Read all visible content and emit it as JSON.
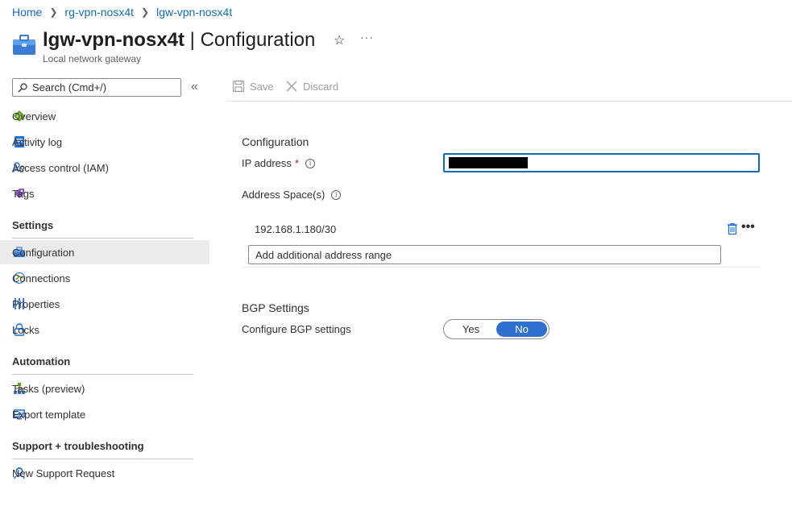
{
  "breadcrumb": {
    "items": [
      "Home",
      "rg-vpn-nosx4t",
      "lgw-vpn-nosx4t"
    ]
  },
  "header": {
    "resource_name": "lgw-vpn-nosx4t",
    "page_name": " | Configuration",
    "resource_type": "Local network gateway",
    "more": "···"
  },
  "sidebar": {
    "search_placeholder": "Search (Cmd+/)",
    "collapse": "«",
    "items_top": [
      {
        "label": "Overview",
        "icon": "overview-icon"
      },
      {
        "label": "Activity log",
        "icon": "activity-log-icon"
      },
      {
        "label": "Access control (IAM)",
        "icon": "iam-icon"
      },
      {
        "label": "Tags",
        "icon": "tag-icon"
      }
    ],
    "sections": [
      {
        "title": "Settings",
        "items": [
          {
            "label": "Configuration",
            "icon": "configuration-icon",
            "active": true
          },
          {
            "label": "Connections",
            "icon": "connections-icon"
          },
          {
            "label": "Properties",
            "icon": "properties-icon"
          },
          {
            "label": "Locks",
            "icon": "lock-icon"
          }
        ]
      },
      {
        "title": "Automation",
        "items": [
          {
            "label": "Tasks (preview)",
            "icon": "tasks-icon"
          },
          {
            "label": "Export template",
            "icon": "export-template-icon"
          }
        ]
      },
      {
        "title": "Support + troubleshooting",
        "items": [
          {
            "label": "New Support Request",
            "icon": "support-icon"
          }
        ]
      }
    ]
  },
  "toolbar": {
    "save_label": "Save",
    "discard_label": "Discard"
  },
  "form": {
    "configuration_heading": "Configuration",
    "ip_label": "IP address",
    "required_mark": "*",
    "info_glyph": "i",
    "address_space_label": "Address Space(s)",
    "address_ranges": [
      "192.168.1.180/30"
    ],
    "add_range_placeholder": "Add additional address range",
    "row_more": "•••",
    "bgp_heading": "BGP Settings",
    "bgp_label": "Configure BGP settings",
    "bgp_options": [
      "Yes",
      "No"
    ],
    "bgp_selected": "No"
  },
  "colors": {
    "link": "#0f6cbd",
    "accent": "#2f6fcd",
    "required": "#a4262c",
    "active_nav": "#edebe9"
  }
}
